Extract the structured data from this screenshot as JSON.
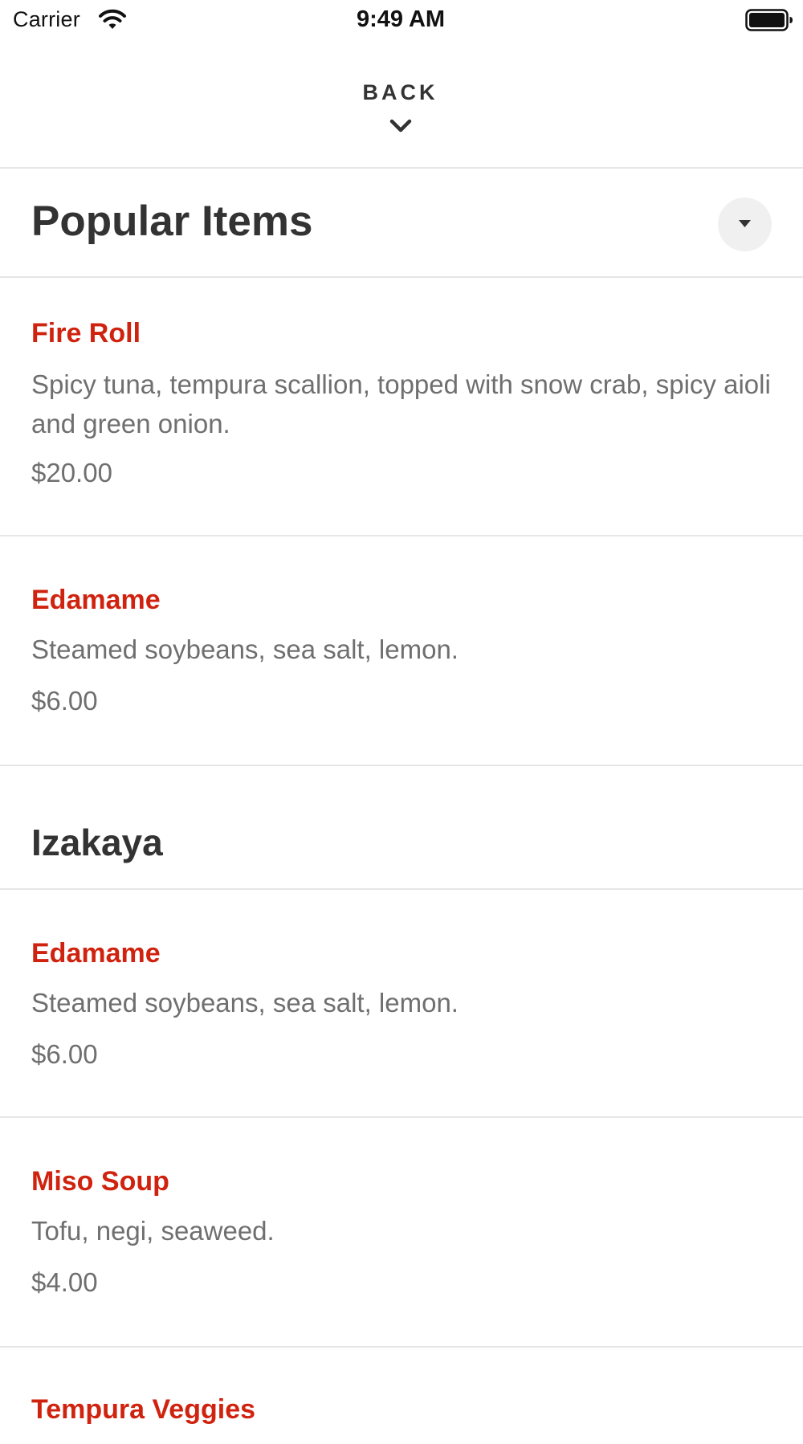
{
  "status_bar": {
    "carrier": "Carrier",
    "time": "9:49 AM",
    "icons": [
      "wifi-icon",
      "battery-icon"
    ]
  },
  "header": {
    "back_label": "BACK",
    "icon": "chevron-down-icon"
  },
  "sections": [
    {
      "title": "Popular Items",
      "items": [
        {
          "name": "Fire Roll",
          "description": "Spicy tuna, tempura scallion, topped with snow crab, spicy aioli and green onion.",
          "price": "$20.00"
        },
        {
          "name": "Edamame",
          "description": "Steamed soybeans, sea salt, lemon.",
          "price": "$6.00"
        }
      ]
    },
    {
      "title": "Izakaya",
      "items": [
        {
          "name": "Edamame",
          "description": "Steamed soybeans, sea salt, lemon.",
          "price": "$6.00"
        },
        {
          "name": "Miso Soup",
          "description": "Tofu, negi, seaweed.",
          "price": "$4.00"
        },
        {
          "name": "Tempura Veggies",
          "description": "",
          "price": ""
        }
      ]
    }
  ],
  "colors": {
    "item_name": "#d0230f",
    "body_text": "#6f6f6f",
    "heading_text": "#333333",
    "divider": "#e6e6e6",
    "dropdown_bg": "#f0f0f0"
  }
}
